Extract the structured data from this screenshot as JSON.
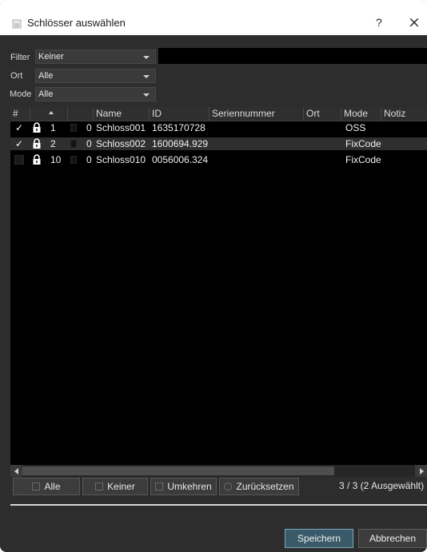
{
  "window": {
    "title": "Schlösser auswählen",
    "help": "?",
    "close": "×"
  },
  "filters": {
    "filter_label": "Filter",
    "filter_value": "Keiner",
    "ort_label": "Ort",
    "ort_value": "Alle",
    "mode_label": "Mode",
    "mode_value": "Alle"
  },
  "table": {
    "columns": [
      "#",
      "",
      "",
      "Name",
      "ID",
      "Seriennummer",
      "Ort",
      "Mode",
      "Notiz"
    ],
    "rows": [
      {
        "checked": true,
        "check_mark": "✓",
        "num": "1",
        "count": "0",
        "name": "Schloss001",
        "id": "1635170728",
        "serial": "",
        "ort": "",
        "mode": "OSS",
        "notiz": ""
      },
      {
        "checked": true,
        "check_mark": "✓",
        "num": "2",
        "count": "0",
        "name": "Schloss002",
        "id": "1600694.929",
        "serial": "",
        "ort": "",
        "mode": "FixCode",
        "notiz": ""
      },
      {
        "checked": false,
        "check_mark": "",
        "num": "10",
        "count": "0",
        "name": "Schloss010",
        "id": "0056006.324",
        "serial": "",
        "ort": "",
        "mode": "FixCode",
        "notiz": ""
      }
    ]
  },
  "actions": {
    "all_label": "Alle",
    "none_label": "Keiner",
    "invert_label": "Umkehren",
    "reset_label": "Zurücksetzen",
    "status": "3 / 3 (2 Ausgewählt)"
  },
  "footer": {
    "save_label": "Speichern",
    "cancel_label": "Abbrechen"
  },
  "colors": {
    "background": "#2d2d2d",
    "table_bg": "#000000",
    "selected_row": "#2f2f2f",
    "save_accent": "#7aa7bd"
  }
}
